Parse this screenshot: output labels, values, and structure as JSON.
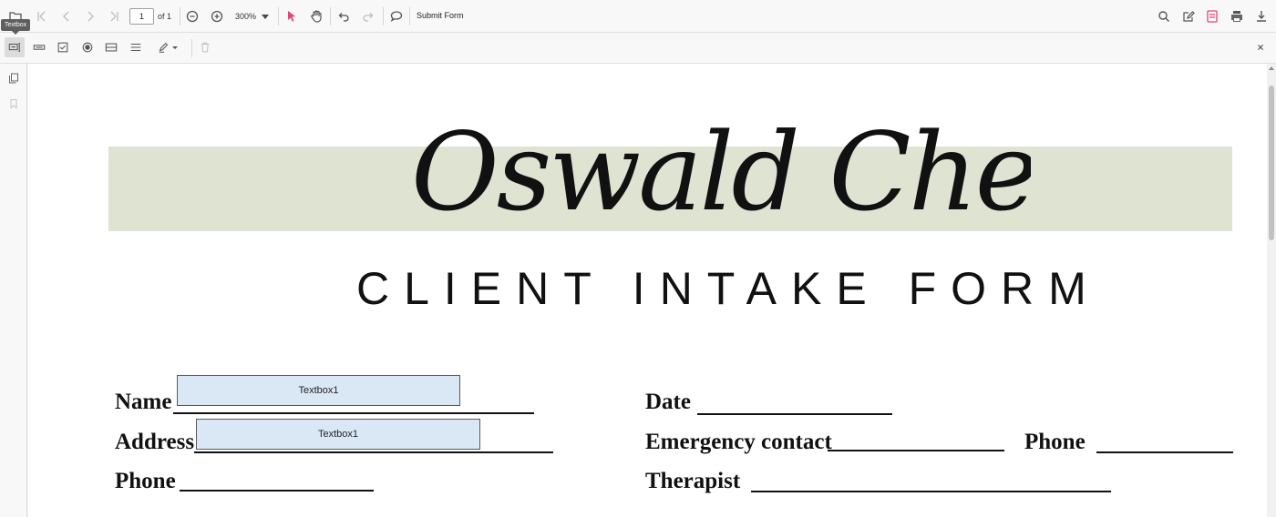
{
  "toolbar": {
    "page_number": "1",
    "page_of": "of 1",
    "zoom": "300%",
    "submit_form": "Submit Form"
  },
  "form_designer": {
    "tooltip": "Textbox"
  },
  "document": {
    "signature_name": "Oswald Chen",
    "title": "CLIENT INTAKE FORM",
    "fields": {
      "name_label": "Name",
      "date_label": "Date",
      "address_label": "Address",
      "emergency_label": "Emergency contact",
      "phone_right_label": "Phone",
      "phone_left_label": "Phone",
      "therapist_label": "Therapist"
    },
    "textboxes": [
      {
        "label": "Textbox1"
      },
      {
        "label": "Textbox1"
      }
    ]
  },
  "colors": {
    "banner": "#dfe3d2",
    "textbox_fill": "#dae8f6",
    "accent_pink": "#e0457b"
  }
}
